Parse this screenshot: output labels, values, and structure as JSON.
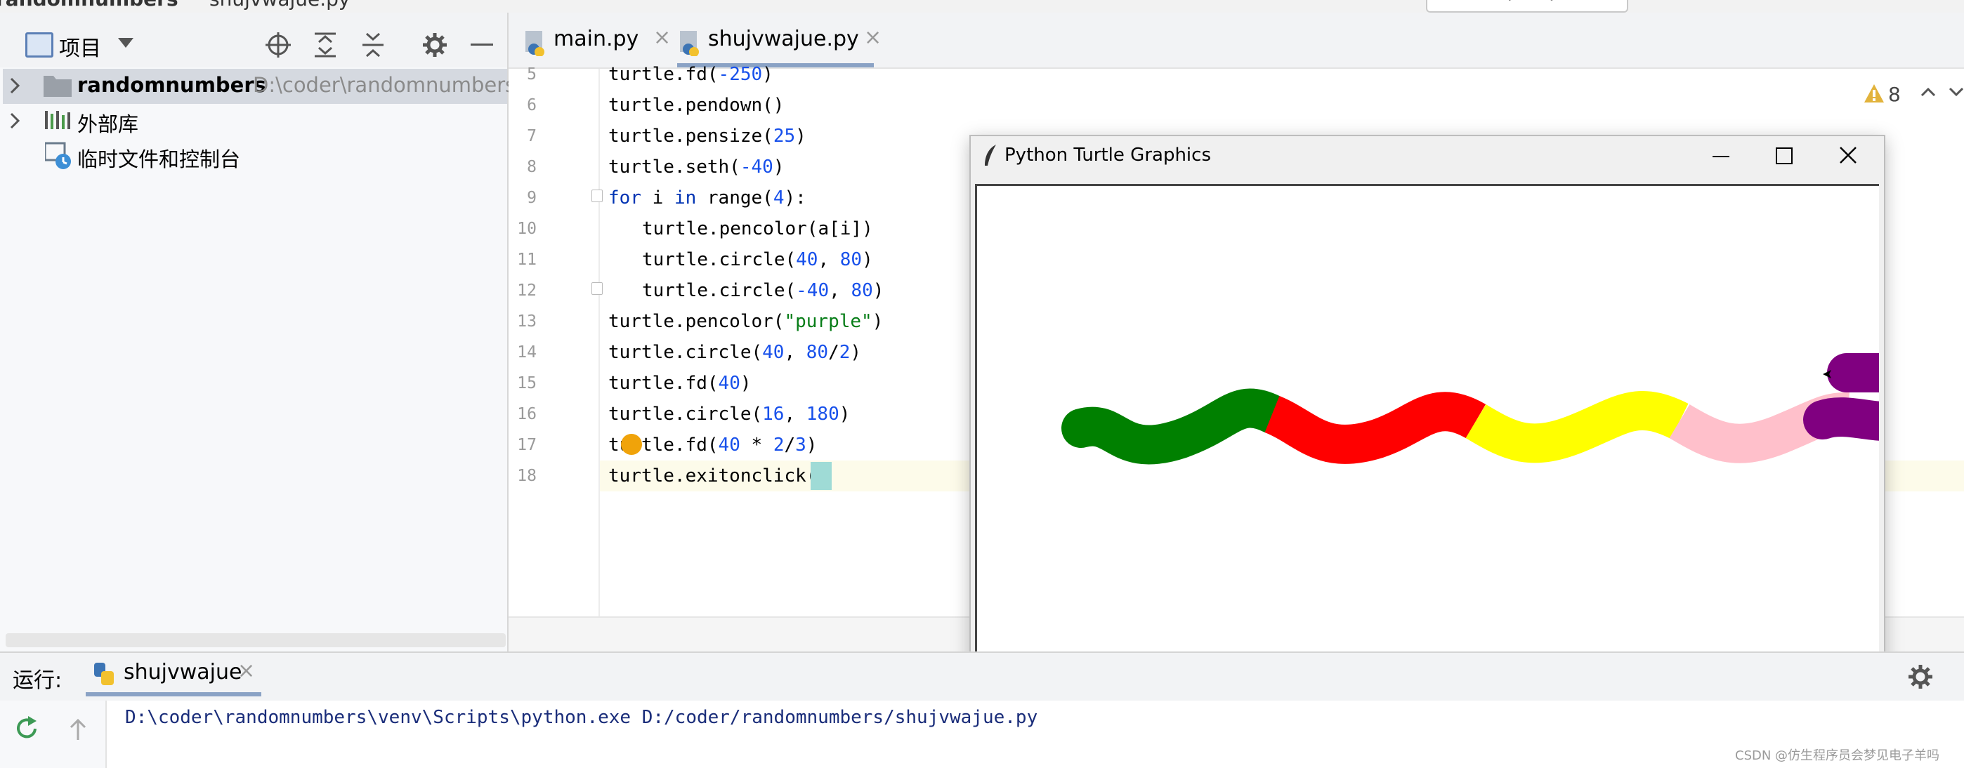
{
  "title_strip": {
    "project": "randomnumbers",
    "file": "shujvwajue.py",
    "run_config": "shujvwajue"
  },
  "project_panel": {
    "title": "项目",
    "items": [
      {
        "name": "randomnumbers",
        "path": "D:\\coder\\randomnumbers"
      },
      {
        "name": "外部库"
      },
      {
        "name": "临时文件和控制台"
      }
    ]
  },
  "editor": {
    "tabs": [
      {
        "label": "main.py"
      },
      {
        "label": "shujvwajue.py",
        "active": true
      }
    ],
    "warnings": "8",
    "line_numbers": [
      "5",
      "6",
      "7",
      "8",
      "9",
      "10",
      "11",
      "12",
      "13",
      "14",
      "15",
      "16",
      "17",
      "18"
    ]
  },
  "turtle_window": {
    "title": "Python Turtle Graphics",
    "snake_colors": [
      "green",
      "red",
      "yellow",
      "pink",
      "purple"
    ]
  },
  "run_panel": {
    "label": "运行:",
    "tab": "shujvwajue",
    "output": "D:\\coder\\randomnumbers\\venv\\Scripts\\python.exe D:/coder/randomnumbers/shujvwajue.py"
  },
  "watermark": "CSDN @仿生程序员会梦见电子羊吗",
  "colors": {
    "keyword": "#0033b3",
    "number": "#1750eb",
    "string": "#067d17",
    "accent": "#8aa2c5"
  }
}
